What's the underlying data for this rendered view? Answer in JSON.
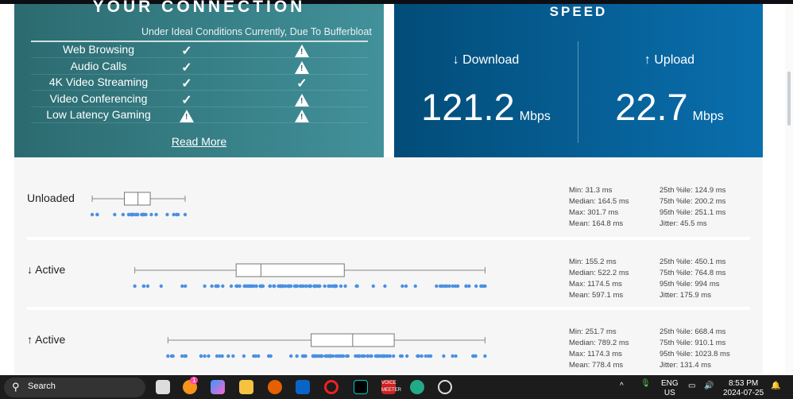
{
  "connection": {
    "title": "YOUR CONNECTION",
    "col1": "Under Ideal Conditions",
    "col2": "Currently, Due To Bufferbloat",
    "rows": [
      {
        "label": "Web Browsing",
        "ideal": "check",
        "current": "warning"
      },
      {
        "label": "Audio Calls",
        "ideal": "check",
        "current": "warning"
      },
      {
        "label": "4K Video Streaming",
        "ideal": "check",
        "current": "check"
      },
      {
        "label": "Video Conferencing",
        "ideal": "check",
        "current": "warning"
      },
      {
        "label": "Low Latency Gaming",
        "ideal": "warning",
        "current": "warning"
      }
    ],
    "read_more": "Read More"
  },
  "speed": {
    "title": "SPEED",
    "download_label": "↓ Download",
    "download_value": "121.2",
    "upload_label": "↑ Upload",
    "upload_value": "22.7",
    "unit": "Mbps"
  },
  "latency": [
    {
      "label": "Unloaded",
      "min": 31.3,
      "q1": 124.9,
      "median": 164.5,
      "q3": 200.2,
      "max": 301.7,
      "stats_left": [
        "Min: 31.3 ms",
        "Median: 164.5 ms",
        "Max: 301.7 ms",
        "Mean: 164.8 ms"
      ],
      "stats_right": [
        "25th %ile: 124.9 ms",
        "75th %ile: 200.2 ms",
        "95th %ile: 251.1 ms",
        "Jitter: 45.5 ms"
      ]
    },
    {
      "label": "↓ Active",
      "min": 155.2,
      "q1": 450.1,
      "median": 522.2,
      "q3": 764.8,
      "max": 1174.5,
      "stats_left": [
        "Min: 155.2 ms",
        "Median: 522.2 ms",
        "Max: 1174.5 ms",
        "Mean: 597.1 ms"
      ],
      "stats_right": [
        "25th %ile: 450.1 ms",
        "75th %ile: 764.8 ms",
        "95th %ile: 994 ms",
        "Jitter: 175.9 ms"
      ]
    },
    {
      "label": "↑ Active",
      "min": 251.7,
      "q1": 668.4,
      "median": 789.2,
      "q3": 910.1,
      "max": 1174.3,
      "stats_left": [
        "Min: 251.7 ms",
        "Median: 789.2 ms",
        "Max: 1174.3 ms",
        "Mean: 778.4 ms"
      ],
      "stats_right": [
        "25th %ile: 668.4 ms",
        "75th %ile: 910.1 ms",
        "95th %ile: 1023.8 ms",
        "Jitter: 131.4 ms"
      ]
    }
  ],
  "colors": {
    "dot": "#4a90e2",
    "teal": "#2b6b70",
    "blue": "#024c78"
  },
  "taskbar": {
    "search": "Search",
    "notification_badge": "1",
    "voicemeeter": "VOICE MEETER",
    "lang": "ENG",
    "region": "US",
    "time": "8:53 PM",
    "date": "2024-07-25"
  }
}
